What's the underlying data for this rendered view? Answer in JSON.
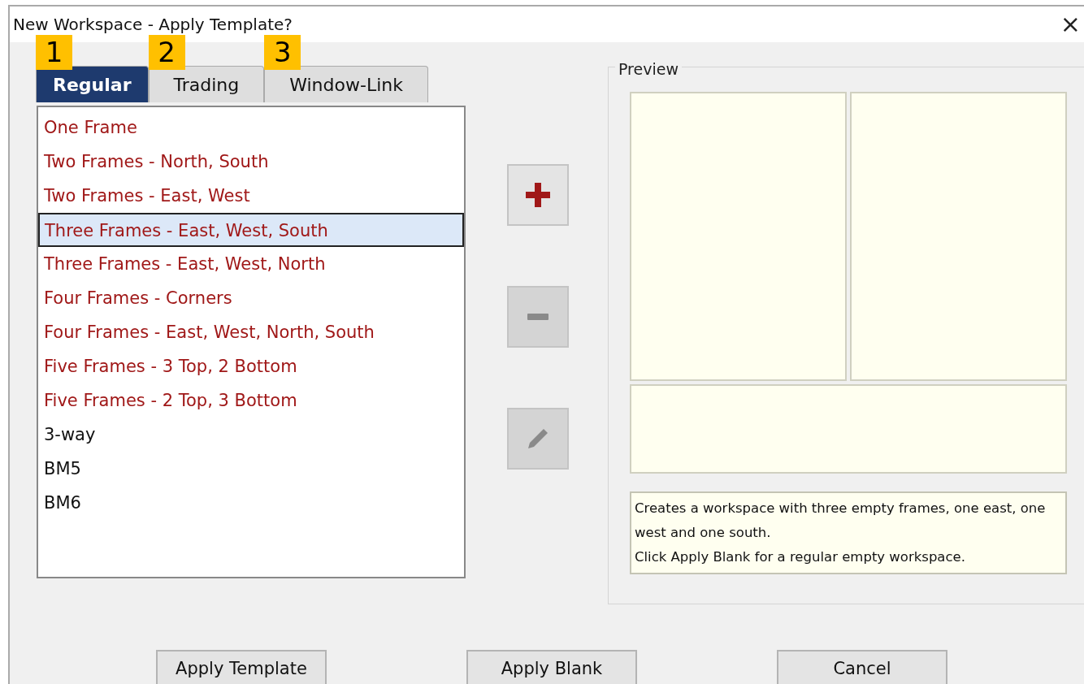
{
  "window": {
    "title": "New Workspace - Apply Template?",
    "close": "×"
  },
  "tabs": [
    {
      "label": "Regular",
      "selected": true,
      "callout": "1"
    },
    {
      "label": "Trading",
      "selected": false,
      "callout": "2"
    },
    {
      "label": "Window-Link",
      "selected": false,
      "callout": "3"
    }
  ],
  "templates": [
    {
      "label": "One Frame",
      "kind": "builtin",
      "selected": false
    },
    {
      "label": "Two Frames - North, South",
      "kind": "builtin",
      "selected": false
    },
    {
      "label": "Two Frames - East, West",
      "kind": "builtin",
      "selected": false
    },
    {
      "label": "Three Frames - East, West, South",
      "kind": "builtin",
      "selected": true
    },
    {
      "label": "Three Frames - East, West, North",
      "kind": "builtin",
      "selected": false
    },
    {
      "label": "Four Frames - Corners",
      "kind": "builtin",
      "selected": false
    },
    {
      "label": "Four Frames - East, West, North, South",
      "kind": "builtin",
      "selected": false
    },
    {
      "label": "Five Frames - 3 Top, 2 Bottom",
      "kind": "builtin",
      "selected": false
    },
    {
      "label": "Five Frames - 2 Top, 3 Bottom",
      "kind": "builtin",
      "selected": false
    },
    {
      "label": "3-way",
      "kind": "custom",
      "selected": false
    },
    {
      "label": "BM5",
      "kind": "custom",
      "selected": false
    },
    {
      "label": "BM6",
      "kind": "custom",
      "selected": false
    }
  ],
  "tools": [
    {
      "kind": "add",
      "disabled": false
    },
    {
      "kind": "remove",
      "disabled": true
    },
    {
      "kind": "edit",
      "disabled": true
    }
  ],
  "preview": {
    "title": "Preview",
    "description": [
      "Creates a workspace with three empty frames, one east, one west and one south.",
      "Click Apply Blank for a regular empty workspace."
    ]
  },
  "buttons": [
    "Apply Template",
    "Apply Blank",
    "Cancel"
  ]
}
